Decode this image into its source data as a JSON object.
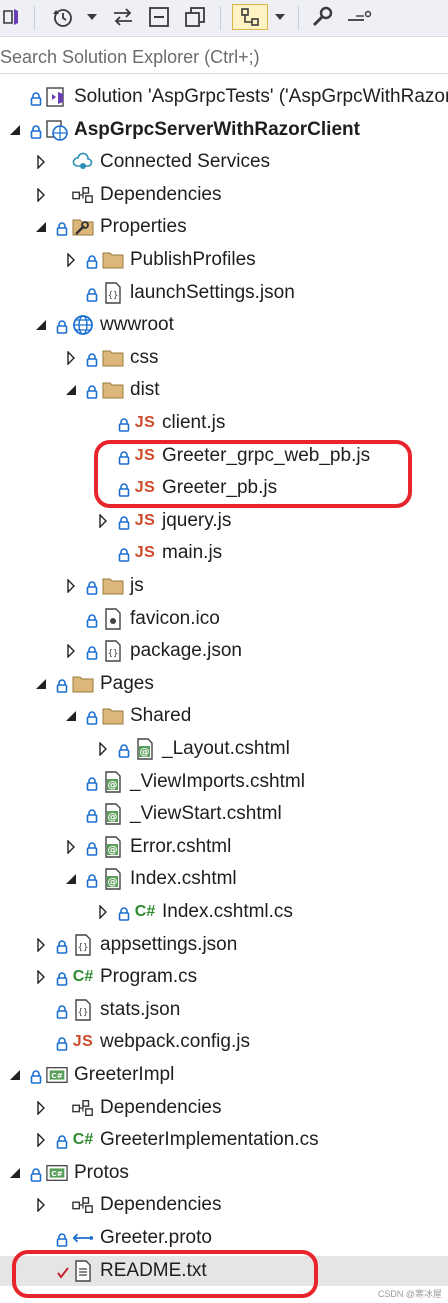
{
  "search": {
    "placeholder": "Search Solution Explorer (Ctrl+;)"
  },
  "colors": {
    "accent": "#e8242c",
    "folder": "#dcb67a",
    "lock": "#1b6fd1",
    "js": "#cf4a2a",
    "csharp": "#2d8a2d"
  },
  "toolbar": {
    "icons": [
      "vs-logo-icon",
      "history-icon",
      "dropdown-icon",
      "sync-icon",
      "collapse-icon",
      "copy-icon",
      "show-all-icon",
      "dropdown-icon",
      "wrench-icon",
      "preview-icon"
    ]
  },
  "tree": [
    {
      "label": "Solution 'AspGrpcTests' ('AspGrpcWithRazorC",
      "icon": "solution-icon",
      "depth": 0,
      "expander": "none",
      "lock": true
    },
    {
      "label": "AspGrpcServerWithRazorClient",
      "icon": "web-project-icon",
      "depth": 0,
      "expander": "expanded",
      "lock": true,
      "bold": true
    },
    {
      "label": "Connected Services",
      "icon": "connected-services-icon",
      "depth": 1,
      "expander": "collapsed",
      "lock": false
    },
    {
      "label": "Dependencies",
      "icon": "dependencies-icon",
      "depth": 1,
      "expander": "collapsed",
      "lock": false
    },
    {
      "label": "Properties",
      "icon": "properties-icon",
      "depth": 1,
      "expander": "expanded",
      "lock": true
    },
    {
      "label": "PublishProfiles",
      "icon": "folder-icon",
      "depth": 2,
      "expander": "collapsed",
      "lock": true
    },
    {
      "label": "launchSettings.json",
      "icon": "json-icon",
      "depth": 2,
      "expander": "none",
      "lock": true
    },
    {
      "label": "wwwroot",
      "icon": "globe-icon",
      "depth": 1,
      "expander": "expanded",
      "lock": true
    },
    {
      "label": "css",
      "icon": "folder-icon",
      "depth": 2,
      "expander": "collapsed",
      "lock": true
    },
    {
      "label": "dist",
      "icon": "folder-icon",
      "depth": 2,
      "expander": "expanded",
      "lock": true
    },
    {
      "label": "client.js",
      "icon": "js-icon",
      "depth": 3,
      "expander": "none",
      "lock": true
    },
    {
      "label": "Greeter_grpc_web_pb.js",
      "icon": "js-icon",
      "depth": 3,
      "expander": "none",
      "lock": true
    },
    {
      "label": "Greeter_pb.js",
      "icon": "js-icon",
      "depth": 3,
      "expander": "none",
      "lock": true
    },
    {
      "label": "jquery.js",
      "icon": "js-icon",
      "depth": 3,
      "expander": "collapsed",
      "lock": true
    },
    {
      "label": "main.js",
      "icon": "js-icon",
      "depth": 3,
      "expander": "none",
      "lock": true
    },
    {
      "label": "js",
      "icon": "folder-icon",
      "depth": 2,
      "expander": "collapsed",
      "lock": true
    },
    {
      "label": "favicon.ico",
      "icon": "favicon-icon",
      "depth": 2,
      "expander": "none",
      "lock": true
    },
    {
      "label": "package.json",
      "icon": "json-icon",
      "depth": 2,
      "expander": "collapsed",
      "lock": true
    },
    {
      "label": "Pages",
      "icon": "folder-icon",
      "depth": 1,
      "expander": "expanded",
      "lock": true
    },
    {
      "label": "Shared",
      "icon": "folder-icon",
      "depth": 2,
      "expander": "expanded",
      "lock": true
    },
    {
      "label": "_Layout.cshtml",
      "icon": "razor-icon",
      "depth": 3,
      "expander": "collapsed",
      "lock": true
    },
    {
      "label": "_ViewImports.cshtml",
      "icon": "razor-icon",
      "depth": 2,
      "expander": "none",
      "lock": true
    },
    {
      "label": "_ViewStart.cshtml",
      "icon": "razor-icon",
      "depth": 2,
      "expander": "none",
      "lock": true
    },
    {
      "label": "Error.cshtml",
      "icon": "razor-icon",
      "depth": 2,
      "expander": "collapsed",
      "lock": true
    },
    {
      "label": "Index.cshtml",
      "icon": "razor-icon",
      "depth": 2,
      "expander": "expanded",
      "lock": true
    },
    {
      "label": "Index.cshtml.cs",
      "icon": "csharp-icon",
      "depth": 3,
      "expander": "collapsed",
      "lock": true
    },
    {
      "label": "appsettings.json",
      "icon": "json-icon",
      "depth": 1,
      "expander": "collapsed",
      "lock": true
    },
    {
      "label": "Program.cs",
      "icon": "csharp-icon",
      "depth": 1,
      "expander": "collapsed",
      "lock": true
    },
    {
      "label": "stats.json",
      "icon": "json-icon",
      "depth": 1,
      "expander": "none",
      "lock": true
    },
    {
      "label": "webpack.config.js",
      "icon": "js-icon",
      "depth": 1,
      "expander": "none",
      "lock": true
    },
    {
      "label": "GreeterImpl",
      "icon": "cs-project-icon",
      "depth": 0,
      "expander": "expanded",
      "lock": true
    },
    {
      "label": "Dependencies",
      "icon": "dependencies-icon",
      "depth": 1,
      "expander": "collapsed",
      "lock": false
    },
    {
      "label": "GreeterImplementation.cs",
      "icon": "csharp-icon",
      "depth": 1,
      "expander": "collapsed",
      "lock": true
    },
    {
      "label": "Protos",
      "icon": "cs-project-icon",
      "depth": 0,
      "expander": "expanded",
      "lock": true
    },
    {
      "label": "Dependencies",
      "icon": "dependencies-icon",
      "depth": 1,
      "expander": "collapsed",
      "lock": false
    },
    {
      "label": "Greeter.proto",
      "icon": "proto-icon",
      "depth": 1,
      "expander": "none",
      "lock": true
    },
    {
      "label": "README.txt",
      "icon": "text-file-icon",
      "depth": 1,
      "expander": "none",
      "lock": false,
      "check": true,
      "selected": true
    }
  ],
  "watermark": "CSDN @寒冰屋"
}
